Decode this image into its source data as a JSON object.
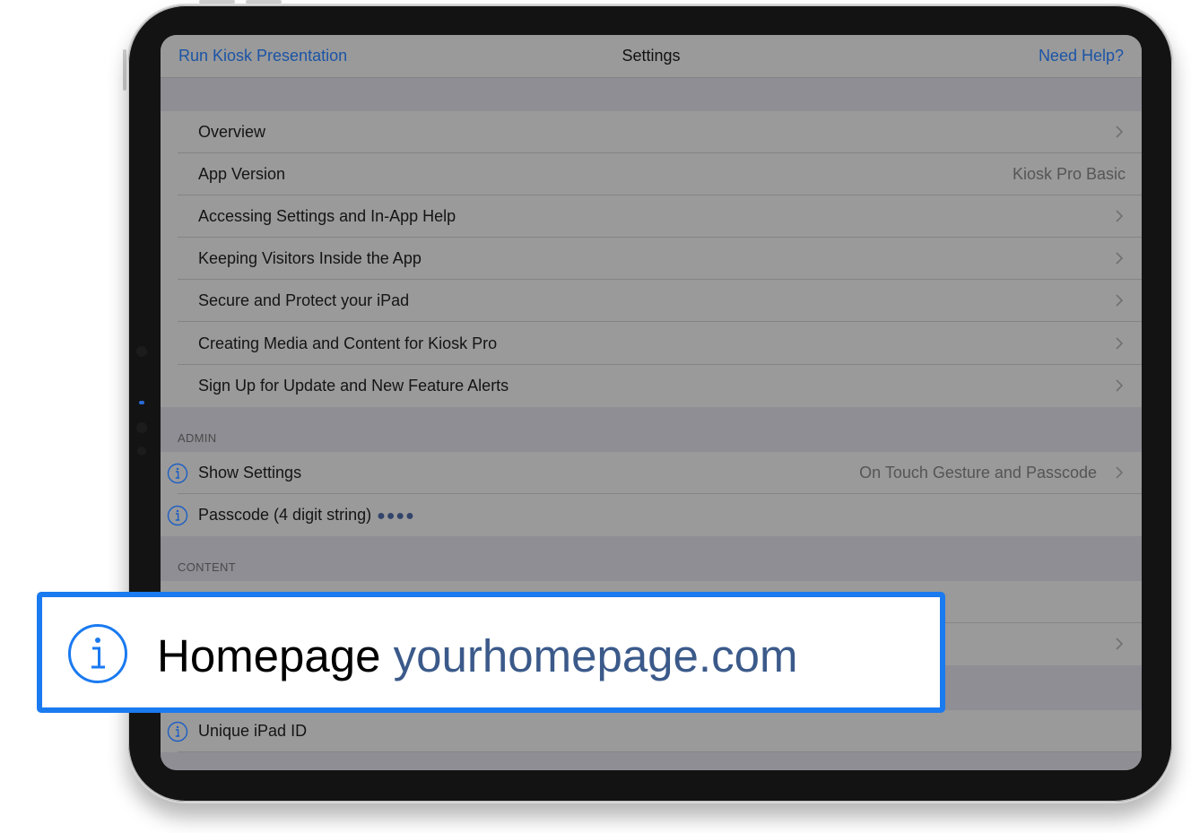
{
  "navbar": {
    "left_button": "Run Kiosk Presentation",
    "title": "Settings",
    "right_button": "Need Help?"
  },
  "help_rows": [
    {
      "label": "Overview",
      "value": "",
      "chevron": true
    },
    {
      "label": "App Version",
      "value": "Kiosk Pro Basic",
      "chevron": false
    },
    {
      "label": "Accessing Settings and In-App Help",
      "value": "",
      "chevron": true
    },
    {
      "label": "Keeping Visitors Inside the App",
      "value": "",
      "chevron": true
    },
    {
      "label": "Secure and Protect your iPad",
      "value": "",
      "chevron": true
    },
    {
      "label": "Creating Media and Content for Kiosk Pro",
      "value": "",
      "chevron": true
    },
    {
      "label": "Sign Up for Update and New Feature Alerts",
      "value": "",
      "chevron": true
    }
  ],
  "admin": {
    "header": "ADMIN",
    "rows": [
      {
        "label": "Show Settings",
        "value": "On Touch Gesture and Passcode",
        "chevron": true,
        "info": true
      },
      {
        "label": "Passcode (4 digit string)",
        "masked_value": "●●●●",
        "info": true
      }
    ]
  },
  "content": {
    "header": "CONTENT",
    "rows": [
      {
        "label": "Homepage",
        "value": "yourhomepage.com",
        "info": true
      },
      {
        "label": "",
        "chevron": true
      }
    ]
  },
  "device": {
    "rows": [
      {
        "label": "Unique iPad ID",
        "info": true
      }
    ]
  },
  "callout": {
    "label": "Homepage",
    "value": "yourhomepage.com",
    "icon": "info-icon"
  },
  "colors": {
    "accent": "#1a7af0",
    "link": "#1b54a6",
    "url_text": "#3b5a8a",
    "screen_dim": "#9a9a9a",
    "frame": "#131313"
  }
}
